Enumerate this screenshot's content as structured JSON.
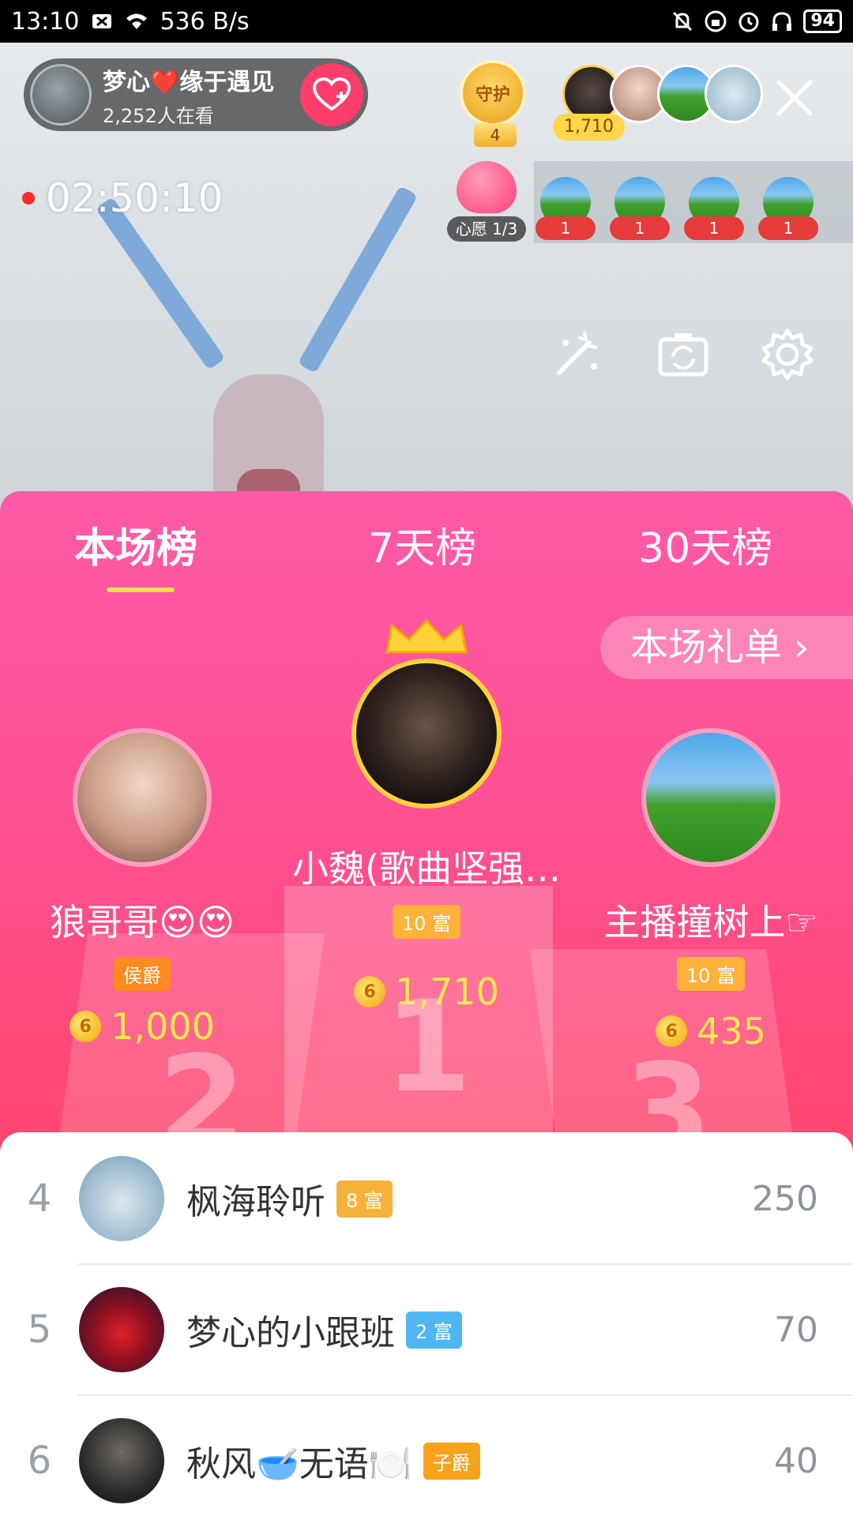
{
  "status_bar": {
    "time": "13:10",
    "network_speed": "536 B/s",
    "battery": "94"
  },
  "live": {
    "host_name": "梦心❤️缘于遇见",
    "viewers": "2,252人在看",
    "guard_label": "守护",
    "guard_count": "4",
    "top_viewer_score": "1,710",
    "timer": "02:50:10",
    "wish_label": "心愿 1/3",
    "gift_counts": [
      "1",
      "1",
      "1",
      "1"
    ]
  },
  "panel": {
    "tabs": [
      "本场榜",
      "7天榜",
      "30天榜"
    ],
    "gift_list_button": "本场礼单 ›",
    "top": [
      {
        "rank": "2",
        "name": "狼哥哥😍😍",
        "badge": "侯爵",
        "score": "1,000"
      },
      {
        "rank": "1",
        "name": "小魏(歌曲坚强…",
        "badge": "10 富",
        "score": "1,710"
      },
      {
        "rank": "3",
        "name": "主播撞树上☞",
        "badge": "10 富",
        "score": "435"
      }
    ]
  },
  "list": [
    {
      "rank": "4",
      "name": "枫海聆听",
      "badge": "8 富",
      "badge_color": "#f7b23b",
      "score": "250"
    },
    {
      "rank": "5",
      "name": "梦心的小跟班",
      "badge": "2 富",
      "badge_color": "#4fb6f2",
      "score": "70"
    },
    {
      "rank": "6",
      "name": "秋风🥣无语🍽️",
      "badge": "子爵",
      "badge_color": "#f7b23b",
      "score": "40"
    }
  ],
  "colors": {
    "panel_top": "#ff5aa8",
    "panel_bottom": "#ff5a5a",
    "score_gold": "#ffe94d",
    "follow": "#ff3d6a"
  }
}
